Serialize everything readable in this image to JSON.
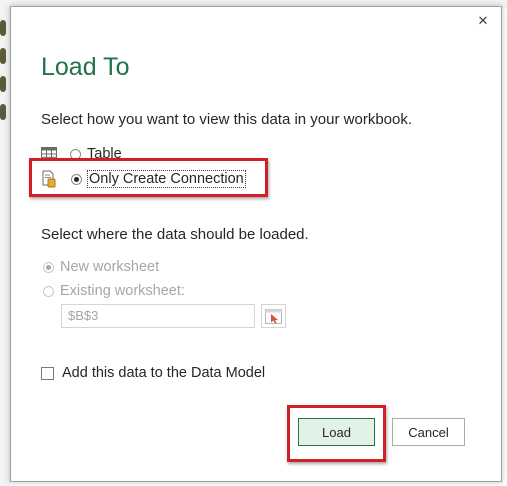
{
  "dialog": {
    "title": "Load To",
    "close_glyph": "✕",
    "view_prompt": "Select how you want to view this data in your workbook.",
    "view_options": [
      {
        "label": "Table",
        "icon": "table-icon",
        "checked": false
      },
      {
        "label": "Only Create Connection",
        "icon": "connection-icon",
        "checked": true
      }
    ],
    "location_prompt": "Select where the data should be loaded.",
    "location_options": [
      {
        "label": "New worksheet",
        "checked": true,
        "disabled": true
      },
      {
        "label": "Existing worksheet:",
        "checked": false,
        "disabled": true
      }
    ],
    "range_value": "$B$3",
    "data_model_label": "Add this data to the Data Model",
    "data_model_checked": false,
    "load_label": "Load",
    "cancel_label": "Cancel"
  },
  "colors": {
    "title": "#217346",
    "highlight": "#d21f26",
    "load_bg": "#e2f2e7"
  }
}
